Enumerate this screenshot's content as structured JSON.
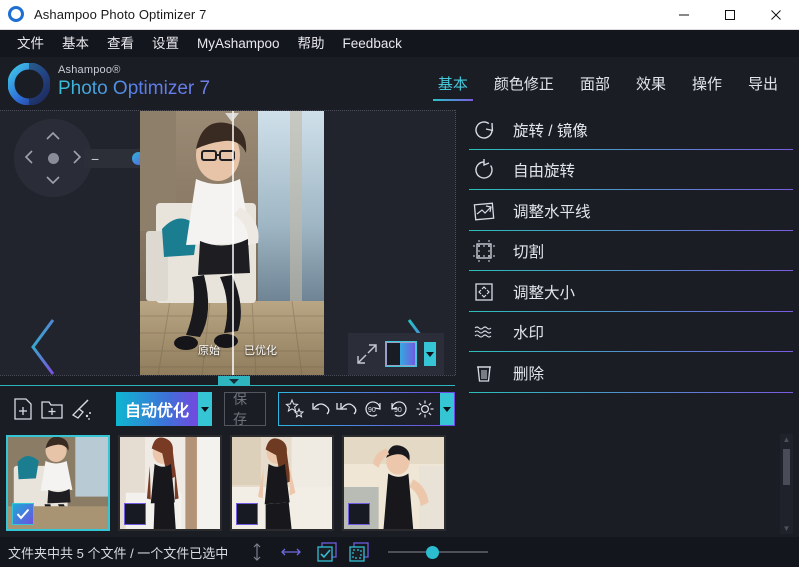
{
  "window": {
    "title": "Ashampoo Photo Optimizer 7",
    "logo_icon": "ashampoo-ring-icon",
    "controls": {
      "minimize": "minimize-icon",
      "maximize": "maximize-icon",
      "close": "close-icon"
    }
  },
  "menubar": {
    "items": [
      {
        "label": "文件"
      },
      {
        "label": "基本"
      },
      {
        "label": "查看"
      },
      {
        "label": "设置"
      },
      {
        "label": "MyAshampoo"
      },
      {
        "label": "帮助"
      },
      {
        "label": "Feedback"
      }
    ]
  },
  "brand": {
    "sup": "Ashampoo®",
    "name": "Photo Optimizer 7",
    "logo_icon": "ashampoo-ring-icon"
  },
  "top_tabs": {
    "active": "基本",
    "items": [
      {
        "label": "基本",
        "active": true
      },
      {
        "label": "颜色修正",
        "active": false
      },
      {
        "label": "面部",
        "active": false
      },
      {
        "label": "效果",
        "active": false
      },
      {
        "label": "操作",
        "active": false
      },
      {
        "label": "导出",
        "active": false
      }
    ]
  },
  "editor": {
    "navpad_icon": "pan-navigation-pad-icon",
    "zoom_slider": {
      "minus": "−",
      "plus": "+",
      "value_percent": 30
    },
    "compare": {
      "original_label": "原始",
      "optimized_label": "已优化",
      "split_position_percent": 50
    },
    "prev_icon": "chevron-left-icon",
    "next_icon": "chevron-right-icon",
    "view_tools": {
      "fullscreen_icon": "expand-arrows-icon",
      "split_view_icon": "split-view-icon",
      "split_view_caret": "chevron-down-icon"
    }
  },
  "right_panel": {
    "items": [
      {
        "label": "旋转 / 镜像",
        "icon": "rotate-mirror-icon"
      },
      {
        "label": "自由旋转",
        "icon": "free-rotate-icon"
      },
      {
        "label": "调整水平线",
        "icon": "straighten-horizon-icon"
      },
      {
        "label": "切割",
        "icon": "crop-icon"
      },
      {
        "label": "调整大小",
        "icon": "resize-icon"
      },
      {
        "label": "水印",
        "icon": "watermark-icon"
      },
      {
        "label": "删除",
        "icon": "trash-icon"
      }
    ]
  },
  "splitter": {
    "collapse_icon": "chevron-down-icon"
  },
  "toolbar": {
    "add_file_icon": "add-file-icon",
    "add_folder_icon": "add-folder-icon",
    "clean_icon": "broom-clean-icon",
    "auto_optimize_label": "自动优化",
    "auto_optimize_caret": "chevron-down-icon",
    "save_label": "保存",
    "save_enabled": false,
    "icon_group": [
      {
        "icon": "magic-stars-icon"
      },
      {
        "icon": "undo-icon"
      },
      {
        "icon": "undo-all-icon"
      },
      {
        "icon": "rotate-left-90-icon"
      },
      {
        "icon": "rotate-right-90-icon"
      },
      {
        "icon": "settings-gear-icon"
      }
    ],
    "icon_group_caret": "chevron-down-icon"
  },
  "filmstrip": {
    "thumbnails": [
      {
        "selected": true,
        "checked": true,
        "alt": "photo-1"
      },
      {
        "selected": false,
        "checked": false,
        "alt": "photo-2"
      },
      {
        "selected": false,
        "checked": false,
        "alt": "photo-3"
      },
      {
        "selected": false,
        "checked": false,
        "alt": "photo-4"
      }
    ],
    "scrollbar": {
      "up_icon": "scroll-up-arrow-icon",
      "down_icon": "scroll-down-arrow-icon"
    }
  },
  "statusbar": {
    "text": "文件夹中共 5 个文件 / 一个文件已选中",
    "vertical_layout_icon": "arrows-vertical-icon",
    "horizontal_layout_icon": "arrows-horizontal-icon",
    "select_all_icon": "select-all-icon",
    "deselect_all_icon": "deselect-all-icon",
    "size_slider_value_percent": 40
  },
  "colors": {
    "accent_cyan": "#35c5d4",
    "accent_purple": "#7048e0",
    "panel_bg": "#1b1d25",
    "editor_bg": "#22242d",
    "menubar_bg": "#14161d",
    "text_primary": "#e4e6ee",
    "text_disabled": "#70737c"
  }
}
